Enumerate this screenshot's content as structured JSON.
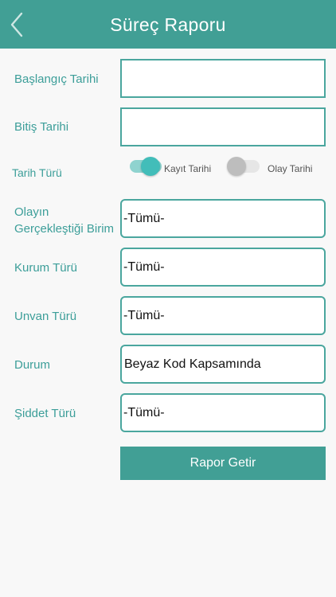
{
  "header": {
    "title": "Süreç Raporu"
  },
  "form": {
    "baslangic_label": "Başlangıç Tarihi",
    "baslangic_value": "",
    "bitis_label": "Bitiş Tarihi",
    "bitis_value": "",
    "tarih_turu_label": "Tarih Türü",
    "tarih_turu_options": [
      {
        "label": "Kayıt Tarihi",
        "on": true
      },
      {
        "label": "Olay Tarihi",
        "on": false
      }
    ],
    "birim_label_line1": "Olayın",
    "birim_label_line2": "Gerçekleştiği Birim",
    "birim_value": "-Tümü-",
    "kurum_label": "Kurum Türü",
    "kurum_value": "-Tümü-",
    "unvan_label": "Unvan Türü",
    "unvan_value": "-Tümü-",
    "durum_label": "Durum",
    "durum_value": "Beyaz Kod Kapsamında",
    "siddet_label": "Şiddet Türü",
    "siddet_value": "-Tümü-"
  },
  "actions": {
    "submit_label": "Rapor Getir"
  },
  "colors": {
    "accent": "#419f95",
    "toggle_on_track": "#8fd3cf",
    "toggle_on_knob": "#42bdb9",
    "toggle_off_track": "#e6e6e6",
    "toggle_off_knob": "#bdbdbd"
  }
}
